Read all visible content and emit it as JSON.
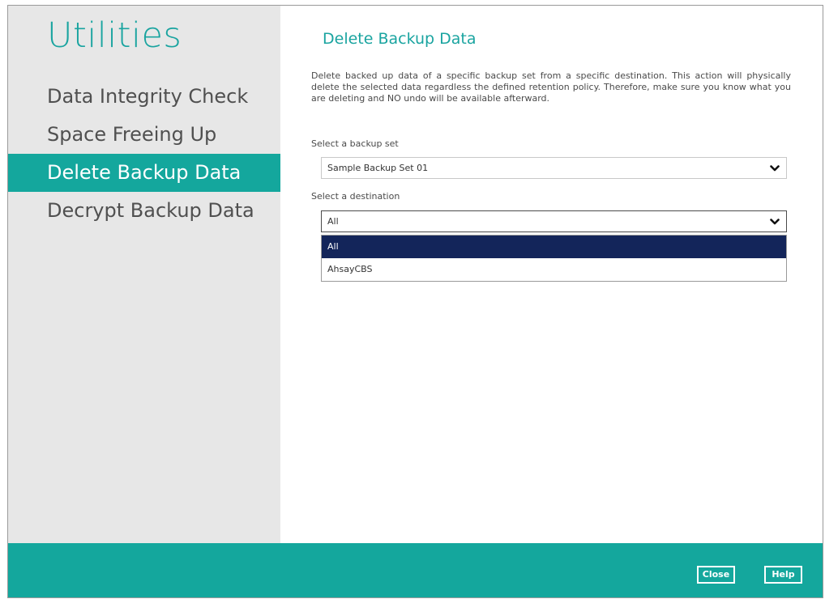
{
  "sidebar": {
    "title": "Utilities",
    "items": [
      {
        "label": "Data Integrity Check",
        "active": false
      },
      {
        "label": "Space Freeing Up",
        "active": false
      },
      {
        "label": "Delete Backup Data",
        "active": true
      },
      {
        "label": "Decrypt Backup Data",
        "active": false
      }
    ]
  },
  "main": {
    "title": "Delete Backup Data",
    "description": "Delete backed up data of a specific backup set from a specific destination. This action will physically delete the selected data regardless the defined retention policy. Therefore, make sure you know what you are deleting and NO undo will be available afterward.",
    "backup_set": {
      "label": "Select a backup set",
      "value": "Sample Backup Set 01"
    },
    "destination": {
      "label": "Select a destination",
      "value": "All",
      "options": [
        "All",
        "AhsayCBS"
      ],
      "highlighted_option": "All"
    }
  },
  "footer": {
    "close_label": "Close",
    "help_label": "Help"
  },
  "colors": {
    "accent": "#14a79d",
    "sidebar_bg": "#e7e7e7",
    "selected_option": "#13255a"
  },
  "icons": {
    "select_arrow": "chevron-down-icon"
  }
}
